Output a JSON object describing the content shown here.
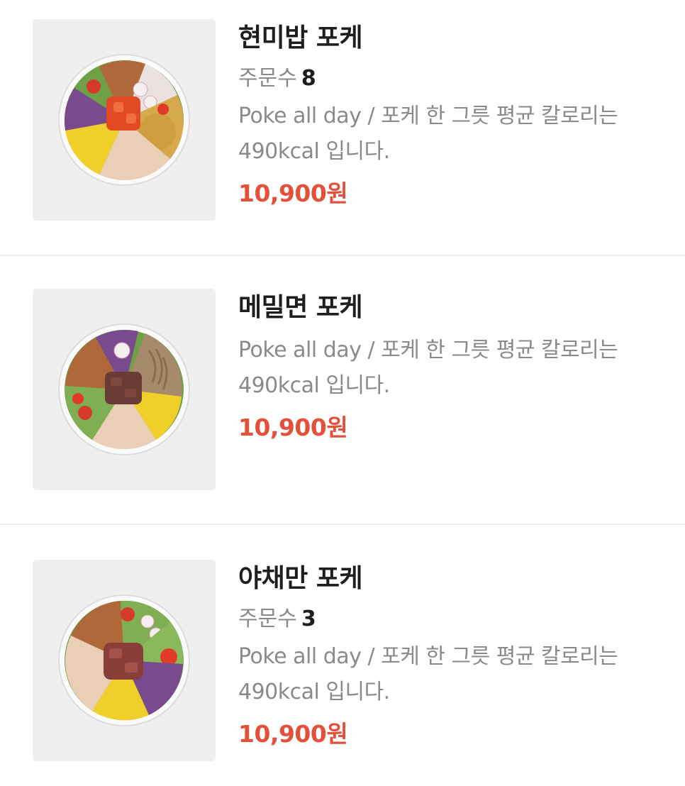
{
  "menu": {
    "items": [
      {
        "name": "현미밥 포케",
        "orders_label": "주문수",
        "orders_count": "8",
        "description": "Poke all day / 포케 한 그릇 평균 칼로리는 490kcal 입니다.",
        "price": "10,900원",
        "image_icon": "poke-bowl-brown-rice"
      },
      {
        "name": "메밀면 포케",
        "description": "Poke all day / 포케 한 그릇 평균 칼로리는 490kcal 입니다.",
        "price": "10,900원",
        "image_icon": "poke-bowl-buckwheat-noodle"
      },
      {
        "name": "야채만 포케",
        "orders_label": "주문수",
        "orders_count": "3",
        "description": "Poke all day / 포케 한 그릇 평균 칼로리는 490kcal 입니다.",
        "price": "10,900원",
        "image_icon": "poke-bowl-vegetable"
      }
    ]
  },
  "colors": {
    "price": "#e4513b",
    "thumb_bg": "#efefef",
    "divider": "#eeeeee",
    "muted_text": "#8a8a8a"
  }
}
